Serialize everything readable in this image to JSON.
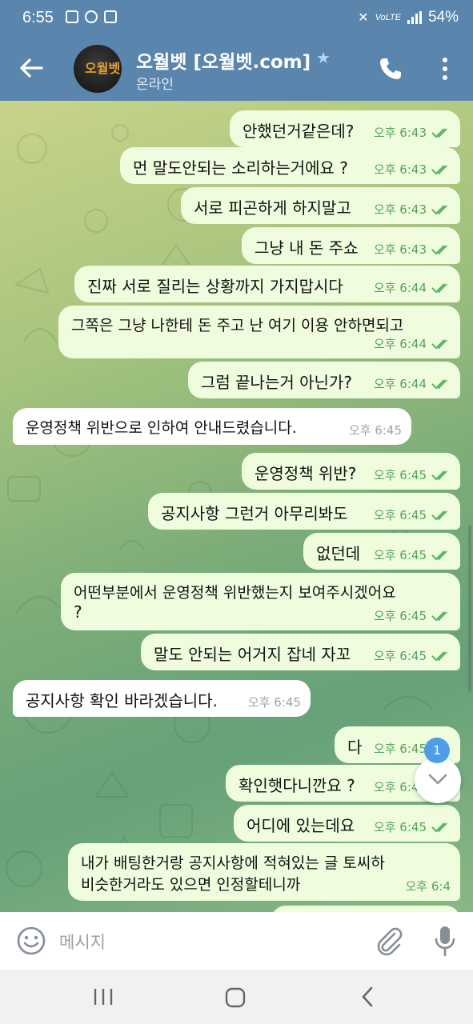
{
  "status_bar": {
    "time": "6:55",
    "battery": "54%"
  },
  "header": {
    "title": "오월벳 [오월벳.com]",
    "subtitle": "온라인",
    "avatar_text": "오월벳"
  },
  "messages": [
    {
      "dir": "out",
      "text": "안했던거같은데?",
      "time": "오후 6:43"
    },
    {
      "dir": "out",
      "text": "먼 말도안되는 소리하는거에요 ?",
      "time": "오후 6:43"
    },
    {
      "dir": "out",
      "text": "서로 피곤하게 하지말고",
      "time": "오후 6:43"
    },
    {
      "dir": "out",
      "text": "그냥 내 돈 주쇼",
      "time": "오후 6:43"
    },
    {
      "dir": "out",
      "text": "진짜 서로 질리는 상황까지 가지맙시다",
      "time": "오후 6:44"
    },
    {
      "dir": "out",
      "text": "그쪽은 그냥 나한테 돈 주고 난 여기 이용 안하면되고",
      "time": "오후 6:44"
    },
    {
      "dir": "out",
      "text": "그럼 끝나는거 아닌가?",
      "time": "오후 6:44"
    },
    {
      "dir": "in",
      "text": "운영정책 위반으로 인하여 안내드렸습니다.",
      "time": "오후 6:45"
    },
    {
      "dir": "out",
      "text": "운영정책 위반?",
      "time": "오후 6:45"
    },
    {
      "dir": "out",
      "text": "공지사항 그런거 아무리봐도",
      "time": "오후 6:45"
    },
    {
      "dir": "out",
      "text": "없던데",
      "time": "오후 6:45"
    },
    {
      "dir": "out",
      "text": "어떤부분에서 운영정책 위반했는지 보여주시겠어요",
      "text2": "?",
      "time": "오후 6:45"
    },
    {
      "dir": "out",
      "text": "말도 안되는 어거지 잡네 자꼬",
      "time": "오후 6:45"
    },
    {
      "dir": "in",
      "text": "공지사항 확인 바라겠습니다.",
      "time": "오후 6:45"
    },
    {
      "dir": "out",
      "text": "다",
      "time": "오후 6:45"
    },
    {
      "dir": "out",
      "text": "확인햇다니깐요 ?",
      "time": "오후 6:45"
    },
    {
      "dir": "out",
      "text": "어디에 있는데요",
      "time": "오후 6:45"
    },
    {
      "dir": "out",
      "text": "내가 배팅한거랑 공지사항에 적혀있는 글 토씨하",
      "text2": "비슷한거라도 있으면 인정할테니까",
      "time": "오후 6:4"
    }
  ],
  "unread_badge": "1",
  "input": {
    "placeholder": "메시지"
  }
}
